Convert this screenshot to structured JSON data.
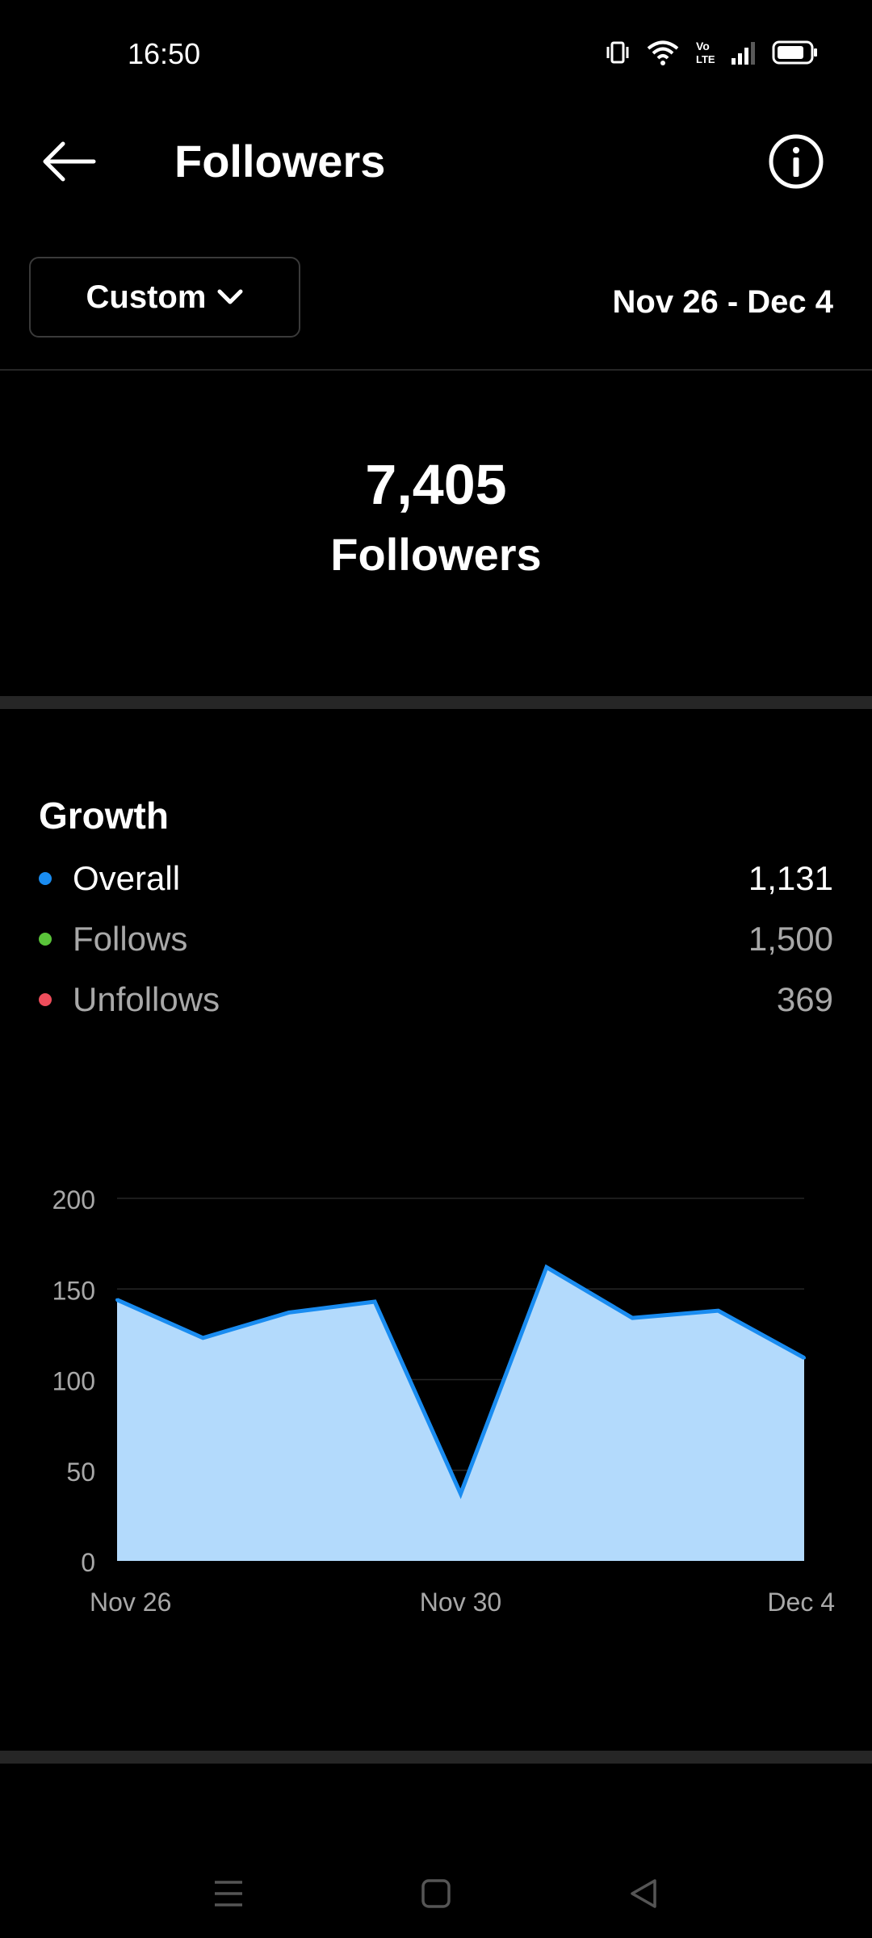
{
  "status_bar": {
    "time": "16:50",
    "icons": [
      "vibrate-icon",
      "wifi-icon",
      "volte-icon",
      "signal-icon",
      "battery-icon"
    ]
  },
  "header": {
    "title": "Followers",
    "back_icon": "back-arrow-icon",
    "info_icon": "info-icon"
  },
  "filter": {
    "dropdown_label": "Custom",
    "date_range": "Nov 26 - Dec 4"
  },
  "summary": {
    "count": "7,405",
    "label": "Followers"
  },
  "growth": {
    "title": "Growth",
    "metrics": [
      {
        "label": "Overall",
        "value": "1,131",
        "color": "#1a8cf0"
      },
      {
        "label": "Follows",
        "value": "1,500",
        "color": "#5ac43a"
      },
      {
        "label": "Unfollows",
        "value": "369",
        "color": "#ee4d5b"
      }
    ]
  },
  "chart_data": {
    "type": "area",
    "x": [
      "Nov 26",
      "Nov 27",
      "Nov 28",
      "Nov 29",
      "Nov 30",
      "Dec 1",
      "Dec 2",
      "Dec 3",
      "Dec 4"
    ],
    "x_tick_labels": [
      "Nov 26",
      "Nov 30",
      "Dec 4"
    ],
    "series": [
      {
        "name": "Overall",
        "values": [
          144,
          123,
          137,
          143,
          37,
          162,
          134,
          138,
          112
        ]
      }
    ],
    "y_ticks": [
      0,
      50,
      100,
      150,
      200
    ],
    "ylim": [
      0,
      200
    ],
    "grid": true,
    "colors": {
      "line": "#1a8cf0",
      "fill": "#b3dafc"
    }
  },
  "colors": {
    "background": "#000000",
    "text": "#ffffff",
    "muted": "#a8a8a8",
    "divider": "#262626"
  },
  "nav": {
    "icons": [
      "menu-icon",
      "home-square-icon",
      "back-triangle-icon"
    ]
  }
}
